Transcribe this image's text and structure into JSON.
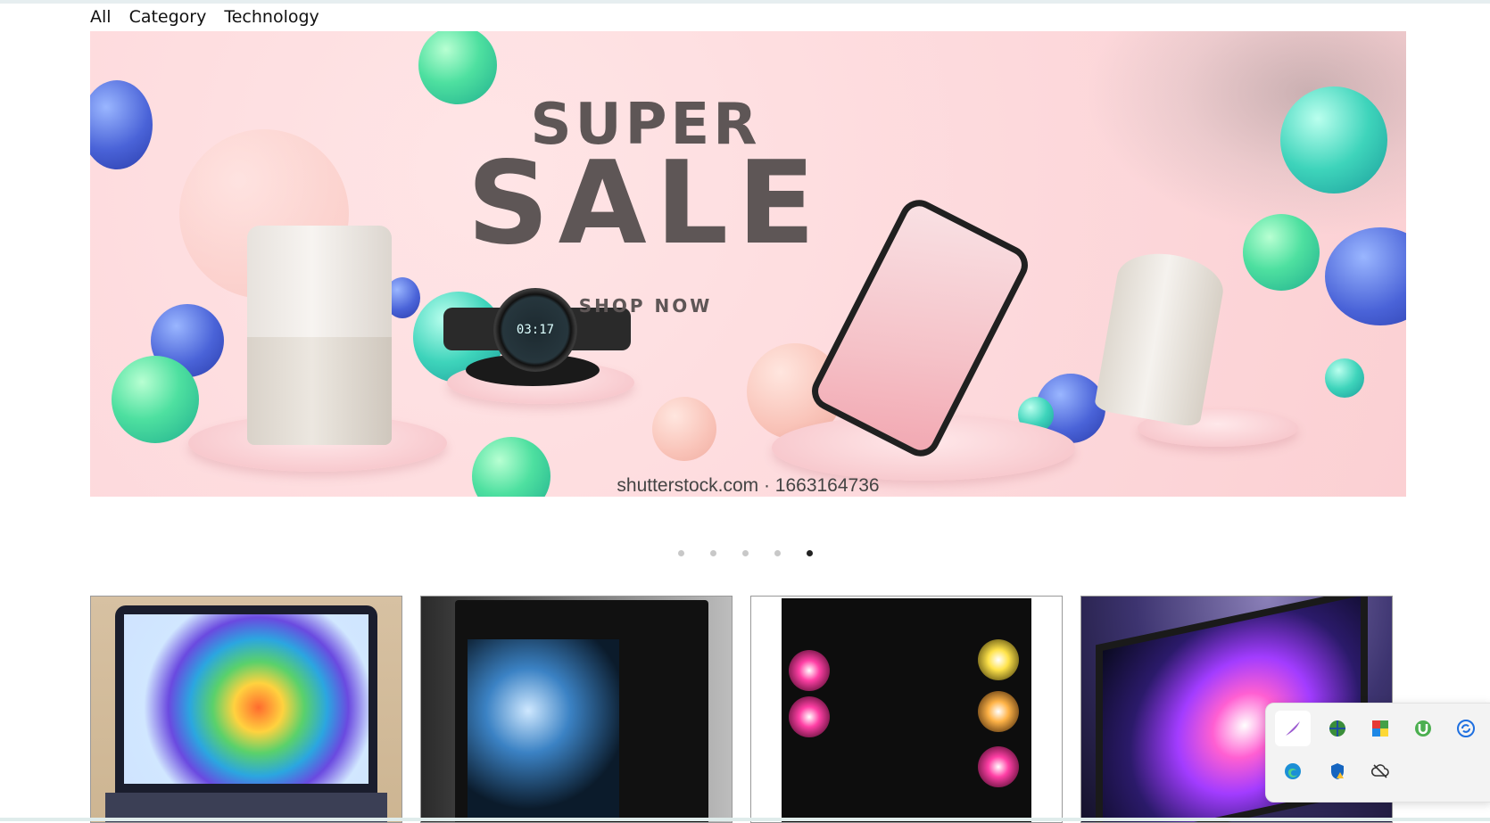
{
  "nav": {
    "items": [
      "All",
      "Category",
      "Technology"
    ]
  },
  "hero": {
    "line1": "SUPER",
    "line2": "SALE",
    "cta": "SHOP NOW",
    "watch_time": "03:17",
    "caption": "shutterstock.com · 1663164736"
  },
  "carousel": {
    "total_slides": 5,
    "active_index": 4
  },
  "products": [
    {
      "name": "laptop"
    },
    {
      "name": "water-cooled-pc"
    },
    {
      "name": "rgb-gaming-pc"
    },
    {
      "name": "rog-monitor"
    }
  ],
  "tray": {
    "icons": [
      "feather-icon",
      "globe-icon",
      "color-grid-icon",
      "utorrent-icon",
      "sync-icon",
      "edge-icon",
      "security-shield-icon",
      "cloud-offline-icon"
    ]
  },
  "colors": {
    "hero_bg": "#fdd9dc",
    "headline": "#5e5656",
    "dot_active": "#222222",
    "dot_inactive": "#c8c8c8"
  }
}
